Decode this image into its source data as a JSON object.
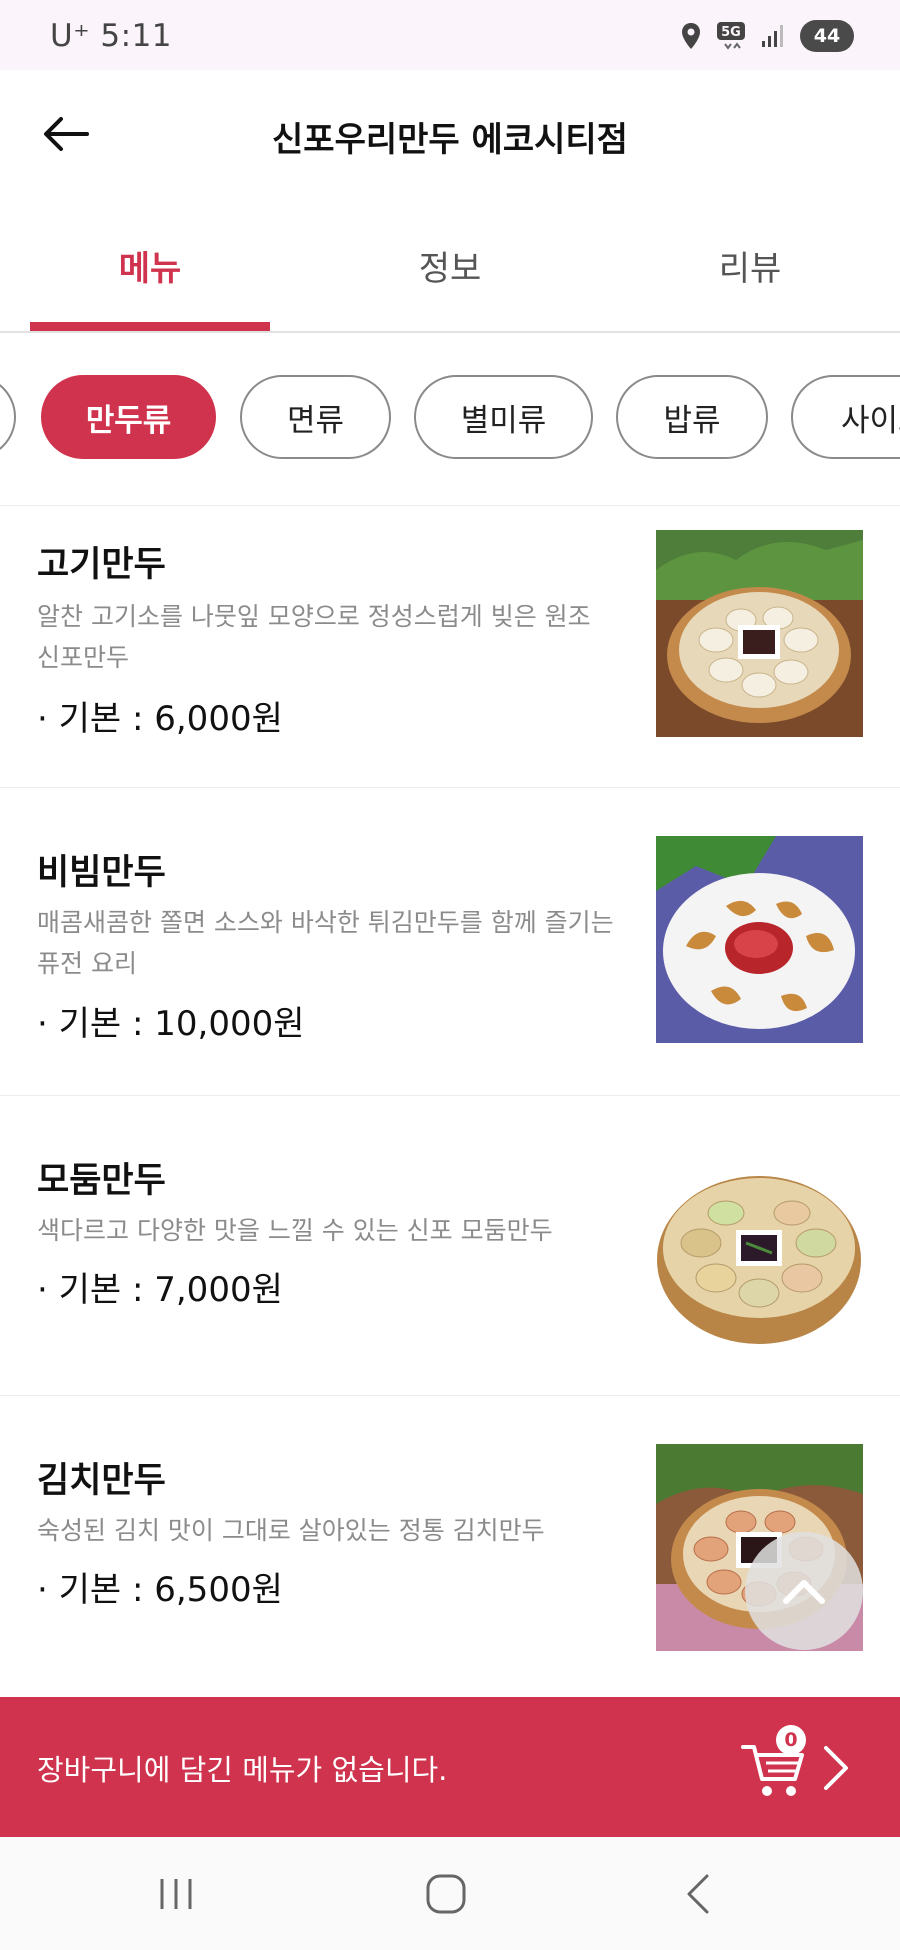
{
  "status_bar": {
    "time": "U⁺ 5:11",
    "battery": "44",
    "network": "5G",
    "icons": [
      "location-icon",
      "5g-icon",
      "signal-icon",
      "battery-icon"
    ]
  },
  "header": {
    "title": "신포우리만두 에코시티점",
    "back_icon": "arrow-left-icon"
  },
  "tabs": [
    {
      "label": "메뉴",
      "active": true
    },
    {
      "label": "정보",
      "active": false
    },
    {
      "label": "리뷰",
      "active": false
    }
  ],
  "categories": [
    {
      "label": "",
      "active": false
    },
    {
      "label": "만두류",
      "active": true
    },
    {
      "label": "면류",
      "active": false
    },
    {
      "label": "별미류",
      "active": false
    },
    {
      "label": "밥류",
      "active": false
    },
    {
      "label": "사이드",
      "active": false
    }
  ],
  "menu": [
    {
      "name": "고기만두",
      "desc": "알찬 고기소를 나뭇잎 모양으로 정성스럽게 빚은 원조 신포만두",
      "price": "· 기본 : 6,000원"
    },
    {
      "name": "비빔만두",
      "desc": "매콤새콤한 쫄면 소스와 바삭한 튀김만두를 함께 즐기는 퓨전 요리",
      "price": "· 기본 : 10,000원"
    },
    {
      "name": "모둠만두",
      "desc": "색다르고 다양한 맛을 느낄 수 있는 신포 모둠만두",
      "price": "· 기본 : 7,000원"
    },
    {
      "name": "김치만두",
      "desc": "숙성된 김치 맛이 그대로 살아있는 정통 김치만두",
      "price": "· 기본 : 6,500원"
    }
  ],
  "cart": {
    "text": "장바구니에 담긴 메뉴가 없습니다.",
    "count": "0",
    "icon": "cart-icon"
  },
  "nav": {
    "icons": [
      "recent-apps-icon",
      "home-icon",
      "back-icon"
    ]
  },
  "colors": {
    "accent": "#d0334d",
    "status_bar_bg": "#fbf5fb",
    "muted_text": "#8b8b8b"
  }
}
